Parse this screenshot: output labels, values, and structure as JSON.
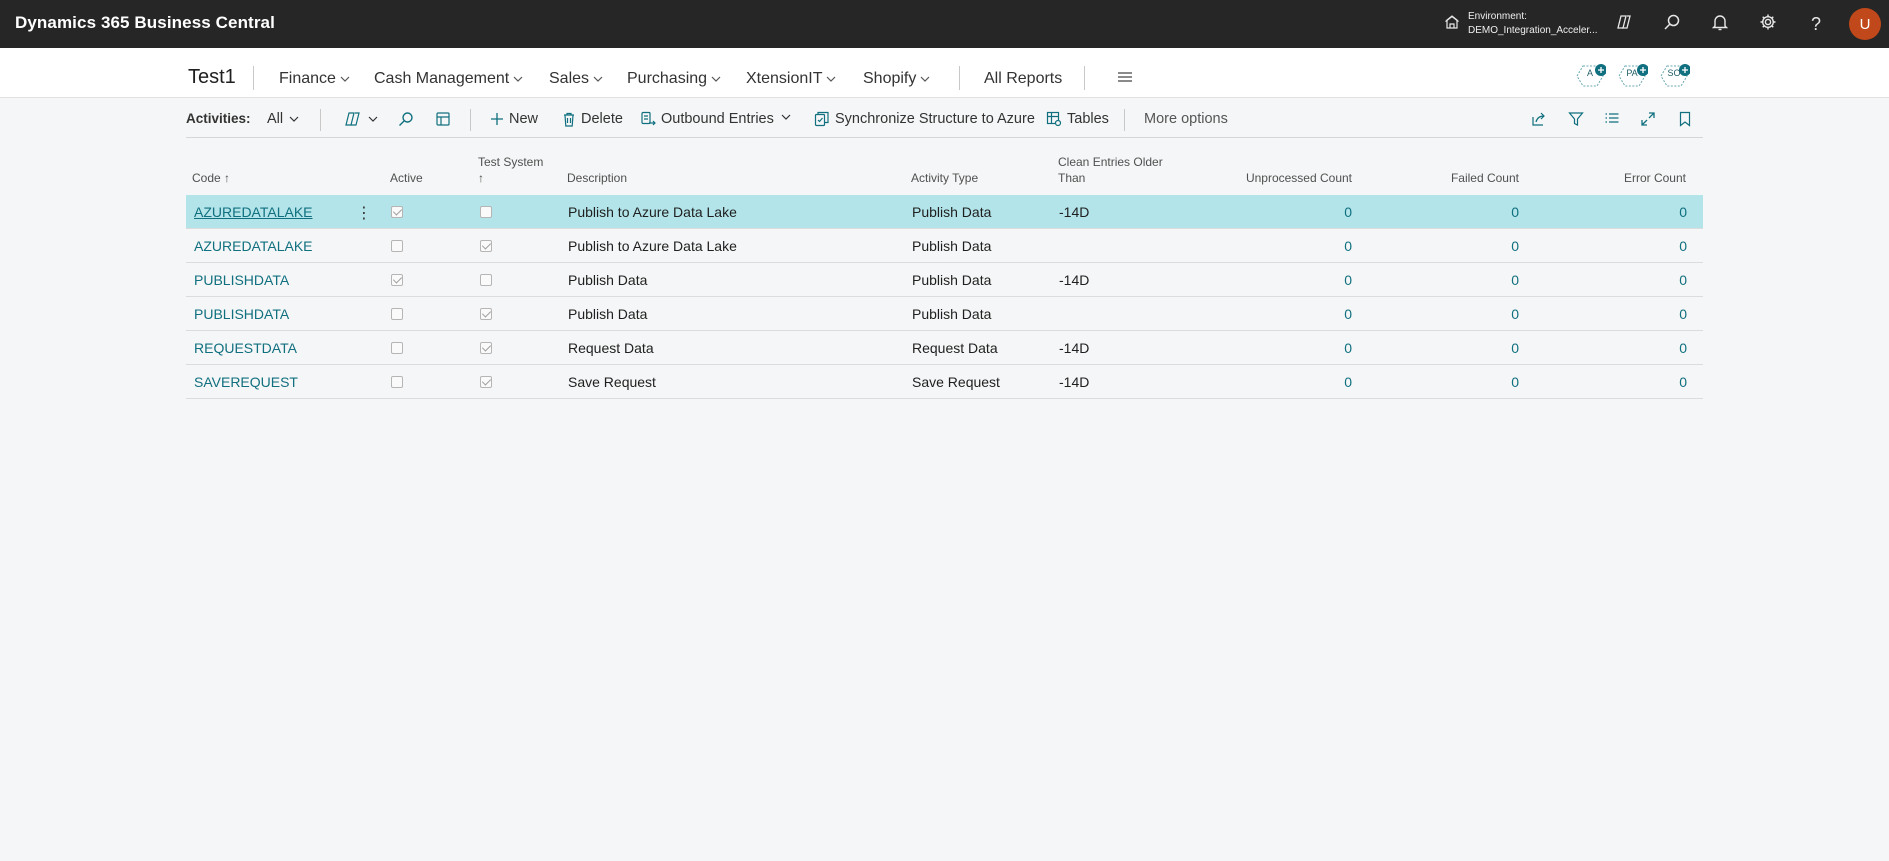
{
  "app": {
    "title": "Dynamics 365 Business Central",
    "environment_label": "Environment:",
    "environment_name": "DEMO_Integration_Acceler...",
    "avatar_initial": "U"
  },
  "nav": {
    "company": "Test1",
    "items": [
      {
        "label": "Finance"
      },
      {
        "label": "Cash Management"
      },
      {
        "label": "Sales"
      },
      {
        "label": "Purchasing"
      },
      {
        "label": "XtensionIT"
      },
      {
        "label": "Shopify"
      }
    ],
    "all_reports": "All Reports",
    "role_badges": [
      "A",
      "PA",
      "SO"
    ]
  },
  "actions": {
    "activities_label": "Activities:",
    "filter_value": "All",
    "new": "New",
    "delete": "Delete",
    "outbound_entries": "Outbound Entries",
    "synchronize": "Synchronize Structure to Azure",
    "tables": "Tables",
    "more_options": "More options"
  },
  "table": {
    "headers": {
      "code": "Code",
      "active": "Active",
      "test_system_1": "Test System",
      "description": "Description",
      "activity_type": "Activity Type",
      "clean_1": "Clean Entries Older",
      "clean_2": "Than",
      "unprocessed": "Unprocessed Count",
      "failed": "Failed Count",
      "error": "Error Count"
    },
    "rows": [
      {
        "code": "AZUREDATALAKE",
        "active": true,
        "test": false,
        "description": "Publish to Azure Data Lake",
        "activity_type": "Publish Data",
        "clean": "-14D",
        "unprocessed": "0",
        "failed": "0",
        "error": "0"
      },
      {
        "code": "AZUREDATALAKE",
        "active": false,
        "test": true,
        "description": "Publish to Azure Data Lake",
        "activity_type": "Publish Data",
        "clean": "",
        "unprocessed": "0",
        "failed": "0",
        "error": "0"
      },
      {
        "code": "PUBLISHDATA",
        "active": true,
        "test": false,
        "description": "Publish Data",
        "activity_type": "Publish Data",
        "clean": "-14D",
        "unprocessed": "0",
        "failed": "0",
        "error": "0"
      },
      {
        "code": "PUBLISHDATA",
        "active": false,
        "test": true,
        "description": "Publish Data",
        "activity_type": "Publish Data",
        "clean": "",
        "unprocessed": "0",
        "failed": "0",
        "error": "0"
      },
      {
        "code": "REQUESTDATA",
        "active": false,
        "test": true,
        "description": "Request Data",
        "activity_type": "Request Data",
        "clean": "-14D",
        "unprocessed": "0",
        "failed": "0",
        "error": "0"
      },
      {
        "code": "SAVEREQUEST",
        "active": false,
        "test": true,
        "description": "Save Request",
        "activity_type": "Save Request",
        "clean": "-14D",
        "unprocessed": "0",
        "failed": "0",
        "error": "0"
      }
    ]
  },
  "colors": {
    "accent": "#10707f",
    "appbar": "#262626",
    "selected_row": "#b2e4e9",
    "avatar": "#c0481a"
  }
}
